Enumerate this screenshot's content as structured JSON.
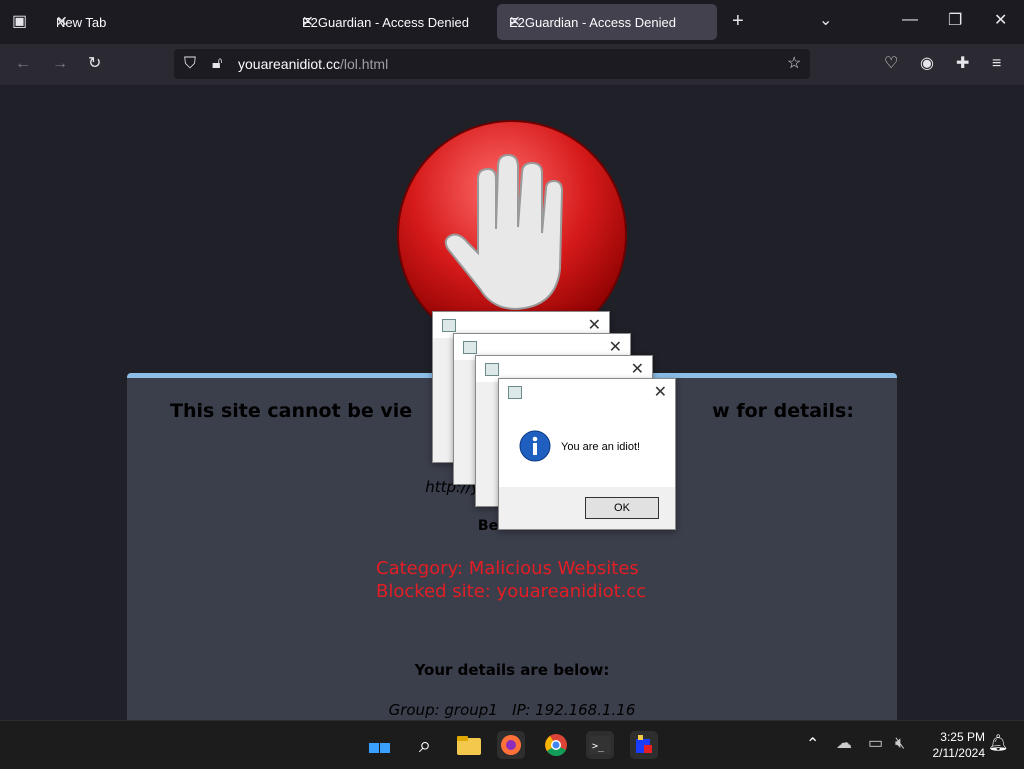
{
  "browser": {
    "tabs": [
      {
        "label": "New Tab"
      },
      {
        "label": "E2Guardian - Access Denied"
      },
      {
        "label": "E2Guardian - Access Denied"
      }
    ],
    "url_domain": "youareanidiot.cc",
    "url_path": "/lol.html"
  },
  "page": {
    "heading_left": "This site cannot be vie",
    "heading_right": "w for details:",
    "url_partial": "http://you",
    "be_partial": "Be",
    "category": "Category: Malicious Websites",
    "blocked": "Blocked site: youareanidiot.cc",
    "details_heading": "Your details are below:",
    "details": "Group: group1   IP: 192.168.1.16"
  },
  "dialog": {
    "message": "You are an idiot!",
    "ok": "OK"
  },
  "taskbar": {
    "time": "3:25 PM",
    "date": "2/11/2024"
  },
  "colors": {
    "accent": "#8bbde6",
    "red": "#e31e24"
  }
}
